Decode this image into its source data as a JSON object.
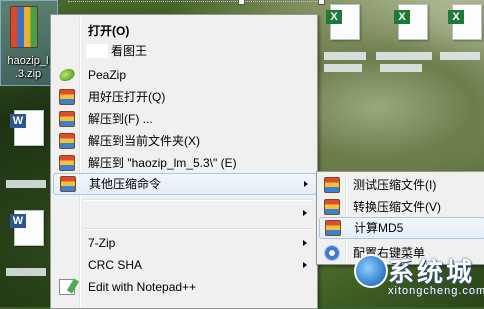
{
  "desktop": {
    "zip_file_label_line1": "haozip_l",
    "zip_file_label_line2": ".3.zip"
  },
  "menu": {
    "items": [
      {
        "label": "打开(O)",
        "icon": "none"
      },
      {
        "label": "看图王",
        "icon": "viewer-icon"
      },
      {
        "label": "PeaZip",
        "icon": "peazip-icon"
      },
      {
        "label": "用好压打开(Q)",
        "icon": "haozip-icon"
      },
      {
        "label": "解压到(F) ...",
        "icon": "haozip-icon"
      },
      {
        "label": "解压到当前文件夹(X)",
        "icon": "haozip-icon"
      },
      {
        "label": "解压到 \"haozip_lm_5.3\\\" (E)",
        "icon": "haozip-icon"
      },
      {
        "label": "其他压缩命令",
        "icon": "haozip-icon"
      },
      {
        "label": "7-Zip",
        "icon": "none"
      },
      {
        "label": "CRC SHA",
        "icon": "none"
      },
      {
        "label": "Edit with Notepad++",
        "icon": "notepad-icon"
      }
    ]
  },
  "submenu": {
    "items": [
      {
        "label": "测试压缩文件(I)",
        "icon": "haozip-icon"
      },
      {
        "label": "转换压缩文件(V)",
        "icon": "haozip-icon"
      },
      {
        "label": "计算MD5",
        "icon": "haozip-icon"
      },
      {
        "label": "配置右键菜单",
        "icon": "gear-icon"
      }
    ]
  },
  "watermark": {
    "text": "系统城",
    "url": "xitongcheng.com"
  },
  "colors": {
    "menu_bg": "#f0f0f0",
    "hover_border": "#a8c7ea",
    "menu_border": "#979797"
  }
}
